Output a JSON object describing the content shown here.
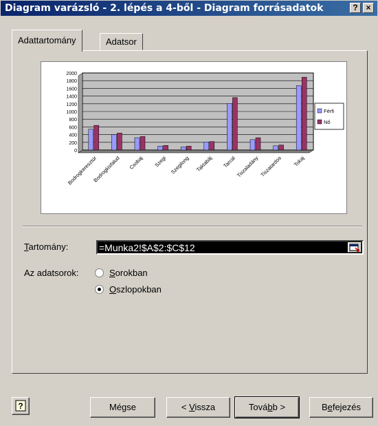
{
  "window": {
    "title": "Diagram varázsló - 2. lépés a 4-ből - Diagram forrásadatok",
    "help_btn": "?",
    "close_btn": "×"
  },
  "tabs": [
    {
      "label": "Adattartomány",
      "active": true
    },
    {
      "label": "Adatsor",
      "active": false
    }
  ],
  "chart_data": {
    "type": "bar",
    "categories": [
      "Bodrogkeresztúr",
      "Bodrogkisfalud",
      "Csobaj",
      "Szegi",
      "Szegilong",
      "Taktabáj",
      "Tarcal",
      "Tiszaladány",
      "Tiszatardos",
      "Tokaj"
    ],
    "series": [
      {
        "name": "Férfi",
        "values": [
          540,
          400,
          320,
          100,
          80,
          210,
          1210,
          270,
          110,
          1670
        ],
        "color": "#9999ff"
      },
      {
        "name": "Nő",
        "values": [
          640,
          440,
          350,
          120,
          100,
          220,
          1360,
          320,
          130,
          1890
        ],
        "color": "#993366"
      }
    ],
    "yticks": [
      "0",
      "200",
      "400",
      "600",
      "800",
      "1000",
      "1200",
      "1400",
      "1600",
      "1800",
      "2000"
    ],
    "ylim": [
      0,
      2000
    ],
    "plot_bg": "#c0c0c0",
    "grid": true,
    "legend": "right"
  },
  "form": {
    "range_label_first": "T",
    "range_label_rest": "artomány:",
    "range_value": "=Munka2!$A$2:$C$12",
    "series_in_label": "Az adatsorok:",
    "radio_rows_u": "S",
    "radio_rows_rest": "orokban",
    "radio_cols_u": "O",
    "radio_cols_rest": "szlopokban",
    "selected": "cols"
  },
  "buttons": {
    "help": "?",
    "cancel": "Mégse",
    "back_pre": "< ",
    "back_u": "V",
    "back_rest": "issza",
    "next_pre": "Tová",
    "next_u": "b",
    "next_rest": "b >",
    "finish_pre": "B",
    "finish_u": "e",
    "finish_rest": "fejezés"
  }
}
